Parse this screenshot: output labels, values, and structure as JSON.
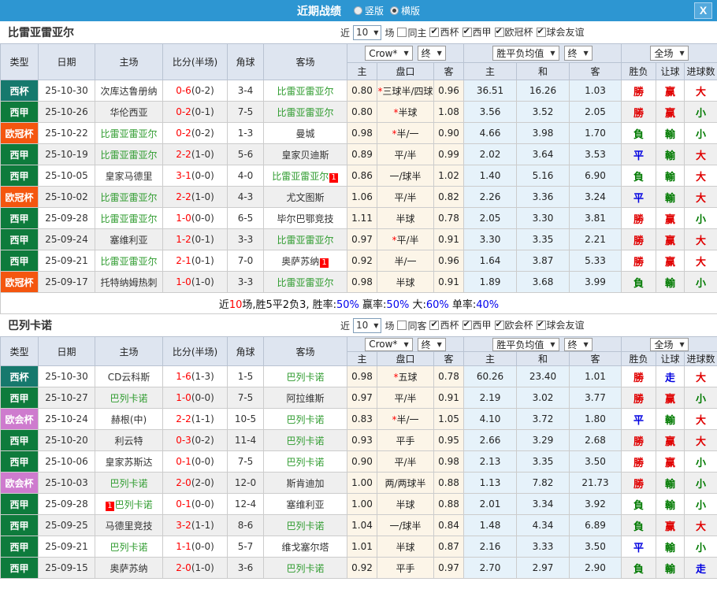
{
  "titlebar": {
    "title": "近期战绩",
    "vertical": {
      "label": "竖版",
      "checked": false
    },
    "horizontal": {
      "label": "横版",
      "checked": true
    },
    "close_label": "X"
  },
  "filter_labels": {
    "near": "近",
    "games": "场"
  },
  "dropdowns": {
    "crow": "Crow*",
    "final": "终",
    "avg": "胜平负均值",
    "full_match": "全场"
  },
  "columns": {
    "type": "类型",
    "date": "日期",
    "home": "主场",
    "score": "比分(半场)",
    "corner": "角球",
    "away": "客场",
    "h": "主",
    "handicap": "盘口",
    "a": "客",
    "avg_h": "主",
    "avg_d": "和",
    "avg_a": "客",
    "result": "胜负",
    "let": "让球",
    "goals": "进球数"
  },
  "colors": {
    "topbar": "#2D96D2",
    "self_team": "#2E9B2E",
    "score": "#FF0000",
    "star": "#FF0000",
    "red_card_bg": "#FF0000",
    "outcome_win": "#E00000",
    "outcome_draw": "#0000E0",
    "outcome_lose": "#007A00",
    "summary_red": "#FF0000",
    "summary_blue": "#0000EE",
    "league_colors": {
      "西杯": "#16796D",
      "西甲": "#0E7B3C",
      "欧冠杯": "#F4560F",
      "欧会杯": "#CE7BCE"
    }
  },
  "outcome_class": {
    "勝": "win",
    "赢": "win",
    "大": "win",
    "平": "draw",
    "走": "draw",
    "負": "lose",
    "輸": "lose",
    "小": "lose"
  },
  "sections": [
    {
      "team": "比雷亚雷亚尔",
      "match_count": "10",
      "same_label": "同主",
      "same_checked": false,
      "league_filters": [
        "西杯",
        "西甲",
        "欧冠杯",
        "球会友谊"
      ],
      "rows": [
        {
          "league": "西杯",
          "date": "25-10-30",
          "home": "次库达鲁册纳",
          "home_self": false,
          "home_card": "",
          "home_card_pos": "",
          "score": "0-6",
          "half": "(0-2)",
          "corners": "3-4",
          "away": "比雷亚雷亚尔",
          "away_self": true,
          "away_card": "",
          "away_card_pos": "",
          "crow_home": "0.80",
          "handicap_star": true,
          "handicap": "三球半/四球",
          "crow_away": "0.96",
          "avg_home": "36.51",
          "avg_draw": "16.26",
          "avg_away": "1.03",
          "result": "勝",
          "let_result": "赢",
          "goal_result": "大"
        },
        {
          "league": "西甲",
          "date": "25-10-26",
          "home": "华伦西亚",
          "home_self": false,
          "home_card": "",
          "home_card_pos": "",
          "score": "0-2",
          "half": "(0-1)",
          "corners": "7-5",
          "away": "比雷亚雷亚尔",
          "away_self": true,
          "away_card": "",
          "away_card_pos": "",
          "crow_home": "0.80",
          "handicap_star": true,
          "handicap": "半球",
          "crow_away": "1.08",
          "avg_home": "3.56",
          "avg_draw": "3.52",
          "avg_away": "2.05",
          "result": "勝",
          "let_result": "赢",
          "goal_result": "小"
        },
        {
          "league": "欧冠杯",
          "date": "25-10-22",
          "home": "比雷亚雷亚尔",
          "home_self": true,
          "home_card": "",
          "home_card_pos": "",
          "score": "0-2",
          "half": "(0-2)",
          "corners": "1-3",
          "away": "曼城",
          "away_self": false,
          "away_card": "",
          "away_card_pos": "",
          "crow_home": "0.98",
          "handicap_star": true,
          "handicap": "半/一",
          "crow_away": "0.90",
          "avg_home": "4.66",
          "avg_draw": "3.98",
          "avg_away": "1.70",
          "result": "負",
          "let_result": "輸",
          "goal_result": "小"
        },
        {
          "league": "西甲",
          "date": "25-10-19",
          "home": "比雷亚雷亚尔",
          "home_self": true,
          "home_card": "",
          "home_card_pos": "",
          "score": "2-2",
          "half": "(1-0)",
          "corners": "5-6",
          "away": "皇家贝迪斯",
          "away_self": false,
          "away_card": "",
          "away_card_pos": "",
          "crow_home": "0.89",
          "handicap_star": false,
          "handicap": "平/半",
          "crow_away": "0.99",
          "avg_home": "2.02",
          "avg_draw": "3.64",
          "avg_away": "3.53",
          "result": "平",
          "let_result": "輸",
          "goal_result": "大"
        },
        {
          "league": "西甲",
          "date": "25-10-05",
          "home": "皇家马德里",
          "home_self": false,
          "home_card": "",
          "home_card_pos": "",
          "score": "3-1",
          "half": "(0-0)",
          "corners": "4-0",
          "away": "比雷亚雷亚尔",
          "away_self": true,
          "away_card": "1",
          "away_card_pos": "after",
          "crow_home": "0.86",
          "handicap_star": false,
          "handicap": "一/球半",
          "crow_away": "1.02",
          "avg_home": "1.40",
          "avg_draw": "5.16",
          "avg_away": "6.90",
          "result": "負",
          "let_result": "輸",
          "goal_result": "大"
        },
        {
          "league": "欧冠杯",
          "date": "25-10-02",
          "home": "比雷亚雷亚尔",
          "home_self": true,
          "home_card": "",
          "home_card_pos": "",
          "score": "2-2",
          "half": "(1-0)",
          "corners": "4-3",
          "away": "尤文图斯",
          "away_self": false,
          "away_card": "",
          "away_card_pos": "",
          "crow_home": "1.06",
          "handicap_star": false,
          "handicap": "平/半",
          "crow_away": "0.82",
          "avg_home": "2.26",
          "avg_draw": "3.36",
          "avg_away": "3.24",
          "result": "平",
          "let_result": "輸",
          "goal_result": "大"
        },
        {
          "league": "西甲",
          "date": "25-09-28",
          "home": "比雷亚雷亚尔",
          "home_self": true,
          "home_card": "",
          "home_card_pos": "",
          "score": "1-0",
          "half": "(0-0)",
          "corners": "6-5",
          "away": "毕尔巴鄂竞技",
          "away_self": false,
          "away_card": "",
          "away_card_pos": "",
          "crow_home": "1.11",
          "handicap_star": false,
          "handicap": "半球",
          "crow_away": "0.78",
          "avg_home": "2.05",
          "avg_draw": "3.30",
          "avg_away": "3.81",
          "result": "勝",
          "let_result": "赢",
          "goal_result": "小"
        },
        {
          "league": "西甲",
          "date": "25-09-24",
          "home": "塞维利亚",
          "home_self": false,
          "home_card": "",
          "home_card_pos": "",
          "score": "1-2",
          "half": "(0-1)",
          "corners": "3-3",
          "away": "比雷亚雷亚尔",
          "away_self": true,
          "away_card": "",
          "away_card_pos": "",
          "crow_home": "0.97",
          "handicap_star": true,
          "handicap": "平/半",
          "crow_away": "0.91",
          "avg_home": "3.30",
          "avg_draw": "3.35",
          "avg_away": "2.21",
          "result": "勝",
          "let_result": "赢",
          "goal_result": "大"
        },
        {
          "league": "西甲",
          "date": "25-09-21",
          "home": "比雷亚雷亚尔",
          "home_self": true,
          "home_card": "",
          "home_card_pos": "",
          "score": "2-1",
          "half": "(0-1)",
          "corners": "7-0",
          "away": "奥萨苏纳",
          "away_self": false,
          "away_card": "1",
          "away_card_pos": "after",
          "crow_home": "0.92",
          "handicap_star": false,
          "handicap": "半/一",
          "crow_away": "0.96",
          "avg_home": "1.64",
          "avg_draw": "3.87",
          "avg_away": "5.33",
          "result": "勝",
          "let_result": "赢",
          "goal_result": "大"
        },
        {
          "league": "欧冠杯",
          "date": "25-09-17",
          "home": "托特纳姆热刺",
          "home_self": false,
          "home_card": "",
          "home_card_pos": "",
          "score": "1-0",
          "half": "(1-0)",
          "corners": "3-3",
          "away": "比雷亚雷亚尔",
          "away_self": true,
          "away_card": "",
          "away_card_pos": "",
          "crow_home": "0.98",
          "handicap_star": false,
          "handicap": "半球",
          "crow_away": "0.91",
          "avg_home": "1.89",
          "avg_draw": "3.68",
          "avg_away": "3.99",
          "result": "負",
          "let_result": "輸",
          "goal_result": "小"
        }
      ],
      "summary": [
        {
          "text": "近"
        },
        {
          "text": "10",
          "color": "red"
        },
        {
          "text": "场,胜5平2负3, 胜率:"
        },
        {
          "text": "50%",
          "color": "blue"
        },
        {
          "text": " 赢率:"
        },
        {
          "text": "50%",
          "color": "blue"
        },
        {
          "text": " 大:"
        },
        {
          "text": "60%",
          "color": "blue"
        },
        {
          "text": " 单率:"
        },
        {
          "text": "40%",
          "color": "blue"
        }
      ]
    },
    {
      "team": "巴列卡诺",
      "match_count": "10",
      "same_label": "同客",
      "same_checked": false,
      "league_filters": [
        "西杯",
        "西甲",
        "欧会杯",
        "球会友谊"
      ],
      "rows": [
        {
          "league": "西杯",
          "date": "25-10-30",
          "home": "CD云科斯",
          "home_self": false,
          "home_card": "",
          "home_card_pos": "",
          "score": "1-6",
          "half": "(1-3)",
          "corners": "1-5",
          "away": "巴列卡诺",
          "away_self": true,
          "away_card": "",
          "away_card_pos": "",
          "crow_home": "0.98",
          "handicap_star": true,
          "handicap": "五球",
          "crow_away": "0.78",
          "avg_home": "60.26",
          "avg_draw": "23.40",
          "avg_away": "1.01",
          "result": "勝",
          "let_result": "走",
          "goal_result": "大"
        },
        {
          "league": "西甲",
          "date": "25-10-27",
          "home": "巴列卡诺",
          "home_self": true,
          "home_card": "",
          "home_card_pos": "",
          "score": "1-0",
          "half": "(0-0)",
          "corners": "7-5",
          "away": "阿拉维斯",
          "away_self": false,
          "away_card": "",
          "away_card_pos": "",
          "crow_home": "0.97",
          "handicap_star": false,
          "handicap": "平/半",
          "crow_away": "0.91",
          "avg_home": "2.19",
          "avg_draw": "3.02",
          "avg_away": "3.77",
          "result": "勝",
          "let_result": "赢",
          "goal_result": "小"
        },
        {
          "league": "欧会杯",
          "date": "25-10-24",
          "home": "赫根(中)",
          "home_self": false,
          "home_card": "",
          "home_card_pos": "",
          "score": "2-2",
          "half": "(1-1)",
          "corners": "10-5",
          "away": "巴列卡诺",
          "away_self": true,
          "away_card": "",
          "away_card_pos": "",
          "crow_home": "0.83",
          "handicap_star": true,
          "handicap": "半/一",
          "crow_away": "1.05",
          "avg_home": "4.10",
          "avg_draw": "3.72",
          "avg_away": "1.80",
          "result": "平",
          "let_result": "輸",
          "goal_result": "大"
        },
        {
          "league": "西甲",
          "date": "25-10-20",
          "home": "利云特",
          "home_self": false,
          "home_card": "",
          "home_card_pos": "",
          "score": "0-3",
          "half": "(0-2)",
          "corners": "11-4",
          "away": "巴列卡诺",
          "away_self": true,
          "away_card": "",
          "away_card_pos": "",
          "crow_home": "0.93",
          "handicap_star": false,
          "handicap": "平手",
          "crow_away": "0.95",
          "avg_home": "2.66",
          "avg_draw": "3.29",
          "avg_away": "2.68",
          "result": "勝",
          "let_result": "赢",
          "goal_result": "大"
        },
        {
          "league": "西甲",
          "date": "25-10-06",
          "home": "皇家苏斯达",
          "home_self": false,
          "home_card": "",
          "home_card_pos": "",
          "score": "0-1",
          "half": "(0-0)",
          "corners": "7-5",
          "away": "巴列卡诺",
          "away_self": true,
          "away_card": "",
          "away_card_pos": "",
          "crow_home": "0.90",
          "handicap_star": false,
          "handicap": "平/半",
          "crow_away": "0.98",
          "avg_home": "2.13",
          "avg_draw": "3.35",
          "avg_away": "3.50",
          "result": "勝",
          "let_result": "赢",
          "goal_result": "小"
        },
        {
          "league": "欧会杯",
          "date": "25-10-03",
          "home": "巴列卡诺",
          "home_self": true,
          "home_card": "",
          "home_card_pos": "",
          "score": "2-0",
          "half": "(2-0)",
          "corners": "12-0",
          "away": "斯肯迪加",
          "away_self": false,
          "away_card": "",
          "away_card_pos": "",
          "crow_home": "1.00",
          "handicap_star": false,
          "handicap": "两/两球半",
          "crow_away": "0.88",
          "avg_home": "1.13",
          "avg_draw": "7.82",
          "avg_away": "21.73",
          "result": "勝",
          "let_result": "輸",
          "goal_result": "小"
        },
        {
          "league": "西甲",
          "date": "25-09-28",
          "home": "巴列卡诺",
          "home_self": true,
          "home_card": "1",
          "home_card_pos": "before",
          "score": "0-1",
          "half": "(0-0)",
          "corners": "12-4",
          "away": "塞维利亚",
          "away_self": false,
          "away_card": "",
          "away_card_pos": "",
          "crow_home": "1.00",
          "handicap_star": false,
          "handicap": "半球",
          "crow_away": "0.88",
          "avg_home": "2.01",
          "avg_draw": "3.34",
          "avg_away": "3.92",
          "result": "負",
          "let_result": "輸",
          "goal_result": "小"
        },
        {
          "league": "西甲",
          "date": "25-09-25",
          "home": "马德里竞技",
          "home_self": false,
          "home_card": "",
          "home_card_pos": "",
          "score": "3-2",
          "half": "(1-1)",
          "corners": "8-6",
          "away": "巴列卡诺",
          "away_self": true,
          "away_card": "",
          "away_card_pos": "",
          "crow_home": "1.04",
          "handicap_star": false,
          "handicap": "一/球半",
          "crow_away": "0.84",
          "avg_home": "1.48",
          "avg_draw": "4.34",
          "avg_away": "6.89",
          "result": "負",
          "let_result": "赢",
          "goal_result": "大"
        },
        {
          "league": "西甲",
          "date": "25-09-21",
          "home": "巴列卡诺",
          "home_self": true,
          "home_card": "",
          "home_card_pos": "",
          "score": "1-1",
          "half": "(0-0)",
          "corners": "5-7",
          "away": "维戈塞尔塔",
          "away_self": false,
          "away_card": "",
          "away_card_pos": "",
          "crow_home": "1.01",
          "handicap_star": false,
          "handicap": "半球",
          "crow_away": "0.87",
          "avg_home": "2.16",
          "avg_draw": "3.33",
          "avg_away": "3.50",
          "result": "平",
          "let_result": "輸",
          "goal_result": "小"
        },
        {
          "league": "西甲",
          "date": "25-09-15",
          "home": "奥萨苏纳",
          "home_self": false,
          "home_card": "",
          "home_card_pos": "",
          "score": "2-0",
          "half": "(1-0)",
          "corners": "3-6",
          "away": "巴列卡诺",
          "away_self": true,
          "away_card": "",
          "away_card_pos": "",
          "crow_home": "0.92",
          "handicap_star": false,
          "handicap": "平手",
          "crow_away": "0.97",
          "avg_home": "2.70",
          "avg_draw": "2.97",
          "avg_away": "2.90",
          "result": "負",
          "let_result": "輸",
          "goal_result": "走"
        }
      ],
      "summary": []
    }
  ]
}
